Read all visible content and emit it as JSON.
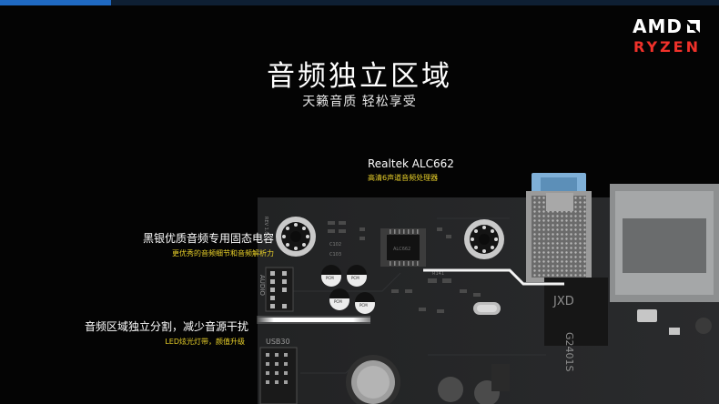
{
  "brand": {
    "logo_text": "AMD",
    "sub_brand": "RYZEN",
    "logo_icon": "amd-arrow-icon",
    "colors": {
      "amd": "#ffffff",
      "ryzen": "#f0312a",
      "accent": "#1f69c2"
    }
  },
  "hero": {
    "title": "音频独立区域",
    "subtitle": "天籁音质 轻松享受"
  },
  "callouts": {
    "realtek": {
      "title": "Realtek ALC662",
      "desc": "高清6声道音频处理器"
    },
    "caps": {
      "title": "黑银优质音频专用固态电容",
      "desc": "更优秀的音频细节和音频解析力"
    },
    "isolation": {
      "title": "音频区域独立分割，减少音源干扰",
      "desc": "LED炫光灯带，颜值升级"
    }
  },
  "board": {
    "header_label": "AUDIO",
    "port_label": "USB30",
    "chip_marking": "JXD",
    "chip_code": "G2401S",
    "colors": {
      "pcb": "#232425",
      "highlight": "#ffffff",
      "audio_jack": "#7fb0d8"
    }
  }
}
